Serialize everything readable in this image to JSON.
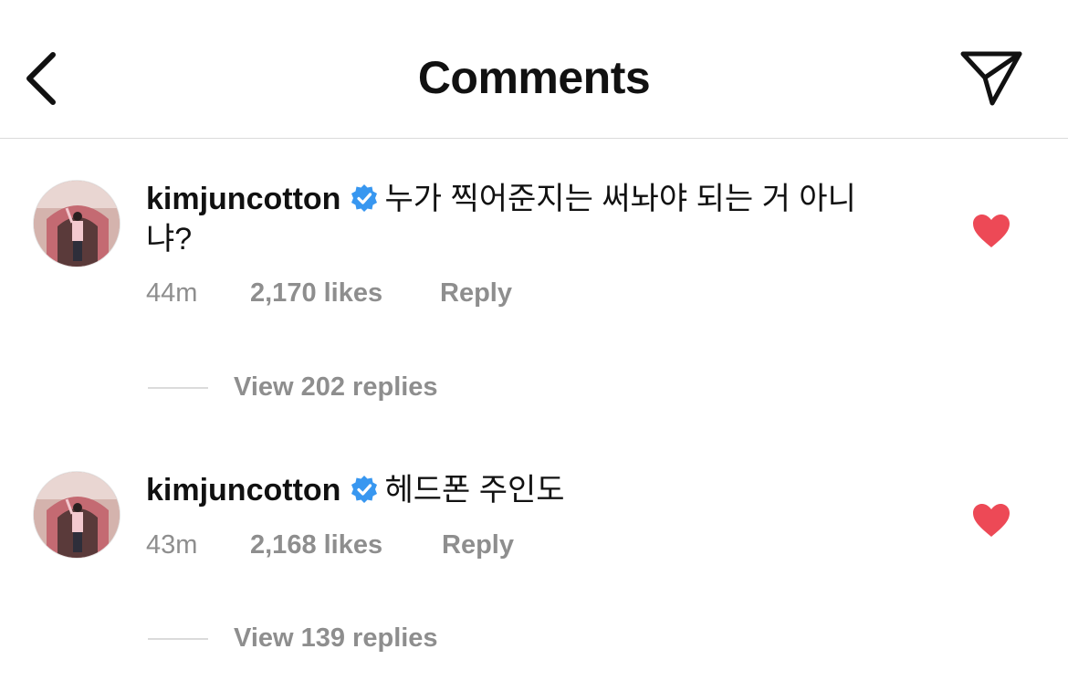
{
  "header": {
    "title": "Comments",
    "back_icon": "chevron-left-icon",
    "share_icon": "paper-plane-icon"
  },
  "colors": {
    "heart": "#ed4956",
    "verified": "#3897f0",
    "meta_text": "#8e8e8e"
  },
  "comments": [
    {
      "username": "kimjuncotton",
      "verified": true,
      "text": "누가 찍어준지는 써놔야 되는 거 아니냐?",
      "time": "44m",
      "likes": "2,170 likes",
      "reply_label": "Reply",
      "view_replies": "View 202 replies",
      "liked": true
    },
    {
      "username": "kimjuncotton",
      "verified": true,
      "text": "헤드폰 주인도",
      "time": "43m",
      "likes": "2,168 likes",
      "reply_label": "Reply",
      "view_replies": "View 139 replies",
      "liked": true
    }
  ]
}
